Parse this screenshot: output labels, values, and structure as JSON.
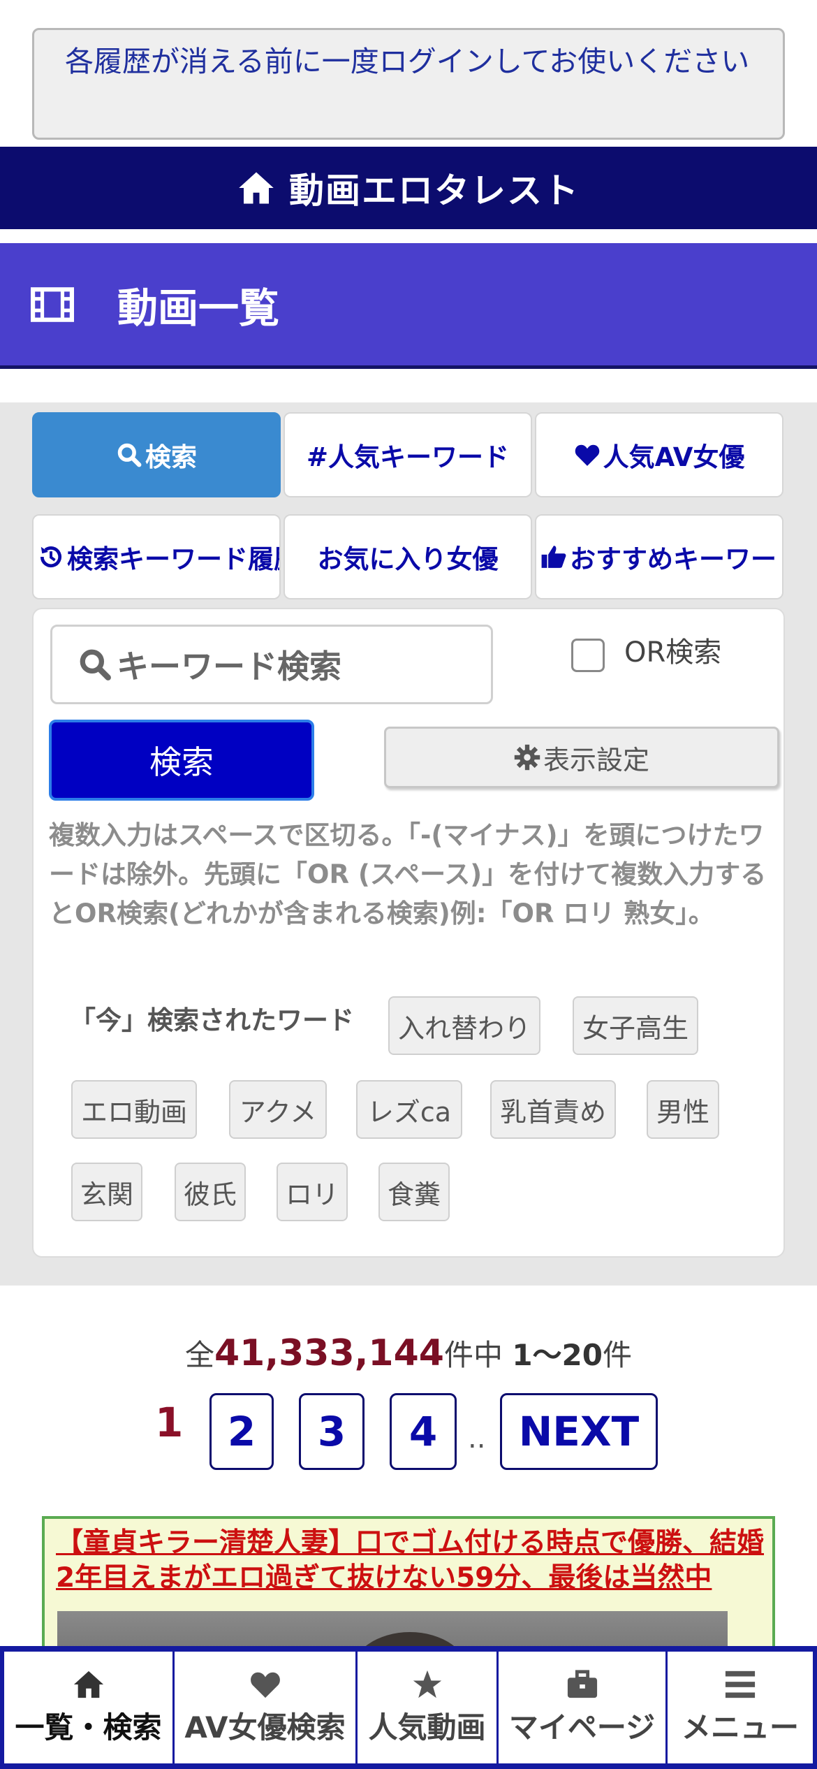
{
  "notice": {
    "text": "各履歴が消える前に一度ログインしてお使いください"
  },
  "header": {
    "site_name": "動画エロタレスト"
  },
  "page": {
    "title": "動画一覧"
  },
  "tabs": [
    {
      "label": "検索",
      "icon": "search-icon"
    },
    {
      "label": "#人気キーワード",
      "icon": ""
    },
    {
      "label": "人気AV女優",
      "icon": "heart-icon"
    },
    {
      "label": "検索キーワード履歴",
      "icon": "history-icon"
    },
    {
      "label": "お気に入り女優",
      "icon": ""
    },
    {
      "label": "おすすめキーワード",
      "icon": "thumbs-up-icon"
    }
  ],
  "search": {
    "placeholder": "キーワード検索",
    "or_label": "OR検索",
    "or_checked": false,
    "button_label": "検索",
    "settings_label": "表示設定",
    "help": "複数入力はスペースで区切る。「-(マイナス)」を頭につけたワードは除外。先頭に「OR (スペース)」を付けて複数入力するとOR検索(どれかが含まれる検索)例:「OR ロリ 熟女」。"
  },
  "trending": {
    "label": "「今」検索されたワード",
    "tags": [
      "入れ替わり",
      "女子高生",
      "エロ動画",
      "アクメ",
      "レズca",
      "乳首責め",
      "男性",
      "玄関",
      "彼氏",
      "ロリ",
      "食糞"
    ]
  },
  "results": {
    "prefix": "全",
    "total": "41,333,144",
    "middle": "件中 ",
    "range": "1〜20",
    "suffix": "件"
  },
  "pagination": {
    "current": "1",
    "pages": [
      "2",
      "3",
      "4"
    ],
    "dots": "..",
    "next": "NEXT"
  },
  "video": {
    "title": "【童貞キラー清楚人妻】口でゴム付ける時点で優勝、結婚2年目えまがエロ過ぎて抜けない59分、最後は当然中"
  },
  "bottom_nav": [
    {
      "label": "一覧・検索",
      "icon": "home-icon"
    },
    {
      "label": "AV女優検索",
      "icon": "heart-icon"
    },
    {
      "label": "人気動画",
      "icon": "star-icon"
    },
    {
      "label": "マイページ",
      "icon": "briefcase-icon"
    },
    {
      "label": "メニュー",
      "icon": "menu-icon"
    }
  ],
  "colors": {
    "header_bg": "#0c0c6e",
    "title_bg": "#4a3fcc",
    "active_tab": "#3a8ad0",
    "search_button": "#0000c2",
    "count_accent": "#7a0f24",
    "video_title": "#cc1010"
  }
}
